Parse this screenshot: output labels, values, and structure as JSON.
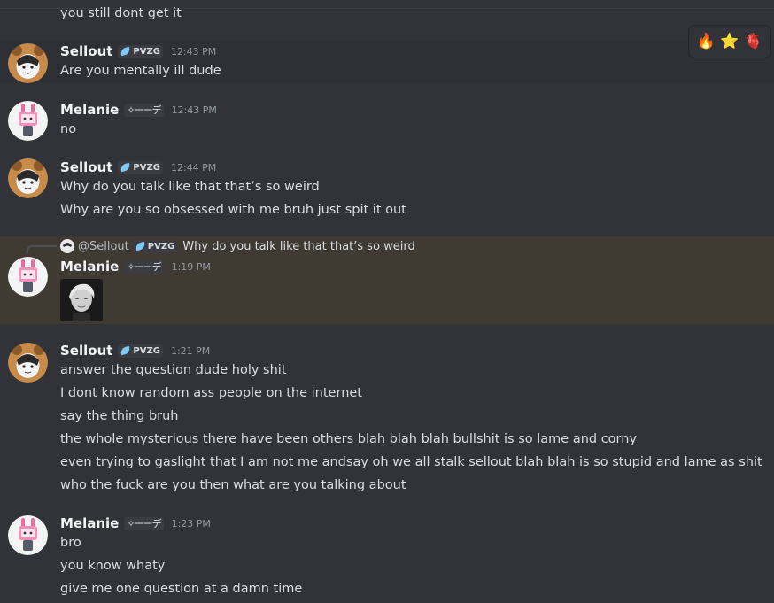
{
  "messages": [
    {
      "user": "",
      "lines": [
        "you still dont get it"
      ]
    },
    {
      "user": "Sellout",
      "tag": "PVZG",
      "time": "12:43 PM",
      "lines": [
        "Are you mentally ill dude"
      ]
    },
    {
      "user": "Melanie",
      "tag": "✧ーーデ",
      "time": "12:43 PM",
      "lines": [
        "no"
      ]
    },
    {
      "user": "Sellout",
      "tag": "PVZG",
      "time": "12:44 PM",
      "lines": [
        "Why do you talk like that that’s so weird",
        "Why are you so obsessed with me bruh just spit it out"
      ]
    },
    {
      "user": "Melanie",
      "tag": "✧ーーデ",
      "time": "1:19 PM",
      "lines": [],
      "reply": {
        "name": "@Sellout",
        "tag": "PVZG",
        "text": "Why do you talk like that that’s so weird"
      }
    },
    {
      "user": "Sellout",
      "tag": "PVZG",
      "time": "1:21 PM",
      "lines": [
        "answer the question dude holy shit",
        "I dont know random ass people on the internet",
        "say the thing bruh",
        "the whole mysterious there have been others blah blah blah bullshit is so lame and corny",
        "even trying to gaslight that I am not me andsay oh we all stalk sellout blah blah is so stupid and lame as shit",
        "who the fuck are you then what are you talking about"
      ]
    },
    {
      "user": "Melanie",
      "tag": "✧ーーデ",
      "time": "1:23 PM",
      "lines": [
        "bro",
        "you know whaty",
        "give me one question at a damn time"
      ]
    }
  ],
  "reactions": [
    "🔥",
    "⭐",
    "🫀"
  ],
  "colors": {
    "background": "#313338",
    "mention_highlight": "#3f3b33",
    "tag_leaf": "#7ec9f5"
  }
}
